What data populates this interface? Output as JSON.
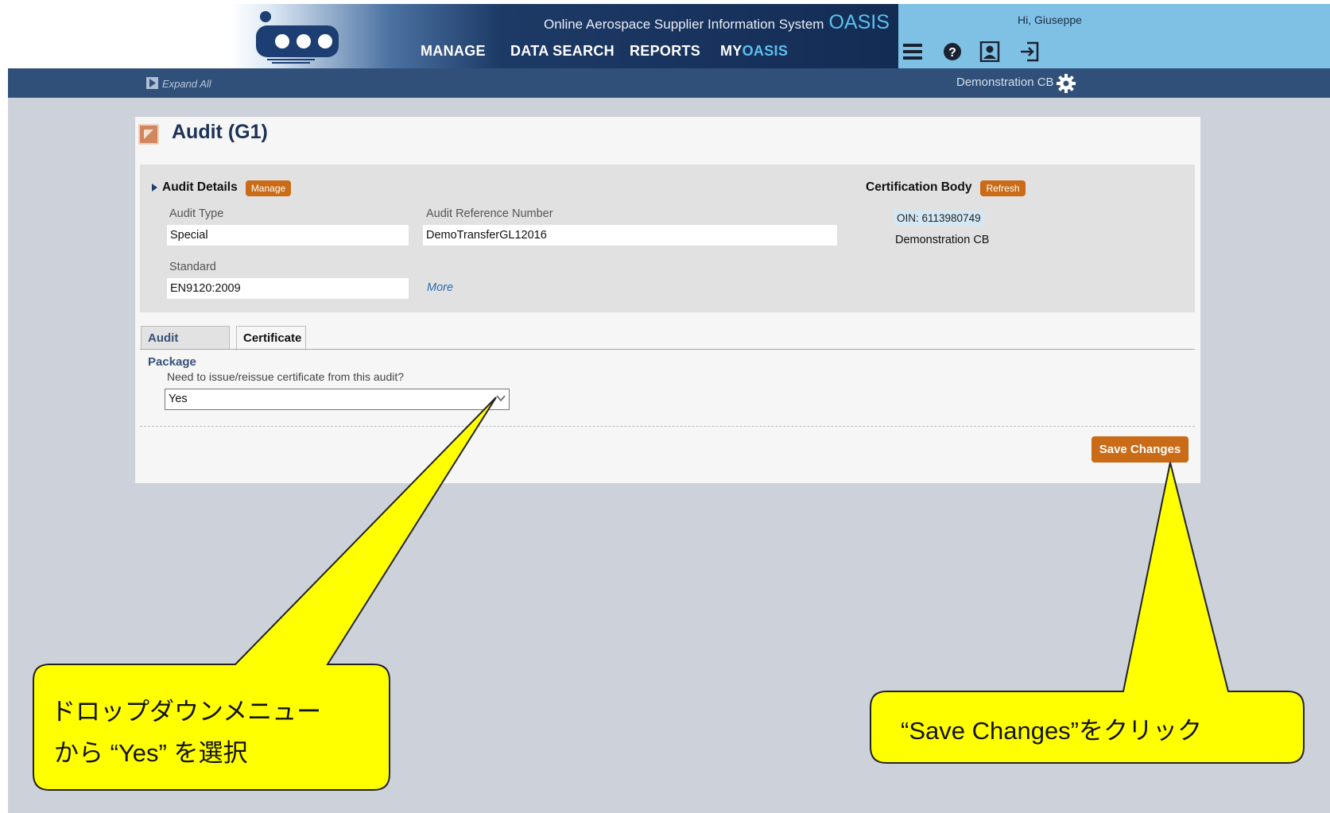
{
  "header": {
    "system_title": "Online Aerospace Supplier Information System",
    "system_abbr": "OASIS",
    "nav": {
      "manage": "MANAGE",
      "data_search": "DATA SEARCH",
      "reports": "REPORTS",
      "my_prefix": "MY",
      "my_suffix": "OASIS"
    },
    "greeting": "Hi, Giuseppe",
    "icons": [
      "menu-icon",
      "help-icon",
      "profile-icon",
      "logout-icon"
    ]
  },
  "subbar": {
    "expand_all": "Expand All",
    "cb_name": "Demonstration CB"
  },
  "page": {
    "title": "Audit (G1)"
  },
  "audit_details": {
    "heading": "Audit Details",
    "manage_label": "Manage",
    "audit_type_label": "Audit Type",
    "audit_type_value": "Special",
    "ref_label": "Audit Reference Number",
    "ref_value": "DemoTransferGL12016",
    "standard_label": "Standard",
    "standard_value": "EN9120:2009",
    "more_link": "More"
  },
  "cert_body": {
    "heading": "Certification Body",
    "refresh_label": "Refresh",
    "oin": "OIN: 6113980749",
    "name": "Demonstration CB"
  },
  "tabs": [
    {
      "label": "Audit Package",
      "active": false
    },
    {
      "label": "Certificate",
      "active": true
    }
  ],
  "certificate": {
    "question": "Need to issue/reissue certificate from this audit?",
    "selected": "Yes",
    "save_label": "Save Changes"
  },
  "callouts": {
    "left_line1": "ドロップダウンメニュー",
    "left_line2": "から “Yes” を選択",
    "right": "“Save Changes”をクリック"
  },
  "colors": {
    "header_dark": "#132c54",
    "header_right": "#7fc1e5",
    "subbar": "#30507a",
    "accent_orange": "#c96b17",
    "callout_yellow": "#ffff00"
  }
}
